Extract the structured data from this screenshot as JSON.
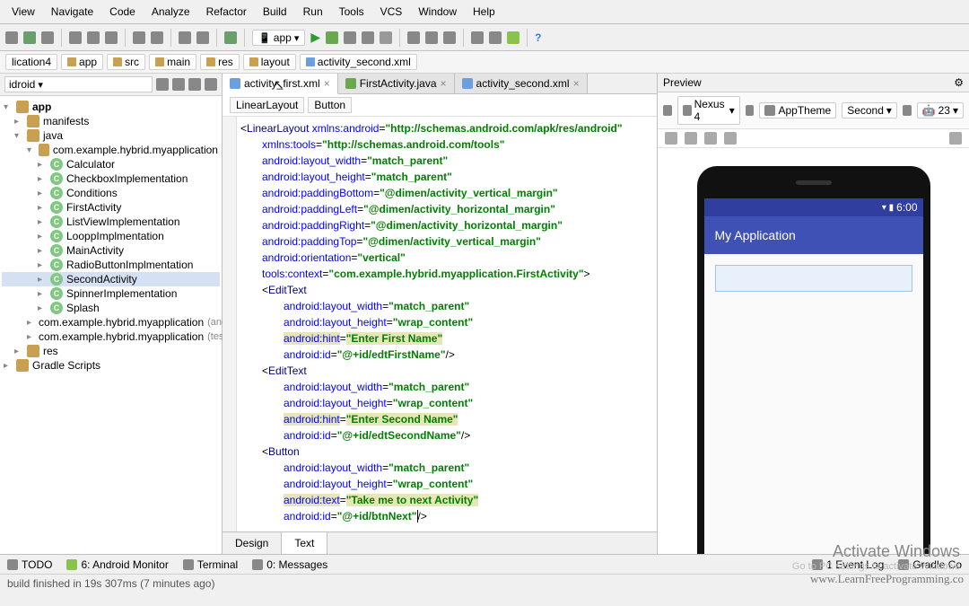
{
  "menu": {
    "items": [
      "View",
      "Navigate",
      "Code",
      "Analyze",
      "Refactor",
      "Build",
      "Run",
      "Tools",
      "VCS",
      "Window",
      "Help"
    ]
  },
  "toolbar": {
    "run_config": "app"
  },
  "breadcrumb": {
    "items": [
      "lication4",
      "app",
      "src",
      "main",
      "res",
      "layout",
      "activity_second.xml"
    ]
  },
  "sidebar": {
    "dropdown": "idroid",
    "root": "app",
    "nodes": [
      {
        "label": "manifests",
        "ico": "folder",
        "indent": 1
      },
      {
        "label": "java",
        "ico": "folder",
        "indent": 1,
        "exp": "▾"
      },
      {
        "label": "com.example.hybrid.myapplication",
        "ico": "folder",
        "indent": 2,
        "exp": "▾"
      },
      {
        "label": "Calculator",
        "ico": "c",
        "indent": 3
      },
      {
        "label": "CheckboxImplementation",
        "ico": "c",
        "indent": 3
      },
      {
        "label": "Conditions",
        "ico": "c",
        "indent": 3
      },
      {
        "label": "FirstActivity",
        "ico": "c",
        "indent": 3
      },
      {
        "label": "ListViewImplementation",
        "ico": "c",
        "indent": 3
      },
      {
        "label": "LooppImplmentation",
        "ico": "c",
        "indent": 3
      },
      {
        "label": "MainActivity",
        "ico": "c",
        "indent": 3
      },
      {
        "label": "RadioButtonImplmentation",
        "ico": "c",
        "indent": 3
      },
      {
        "label": "SecondActivity",
        "ico": "c",
        "indent": 3,
        "sel": true
      },
      {
        "label": "SpinnerImplementation",
        "ico": "c",
        "indent": 3
      },
      {
        "label": "Splash",
        "ico": "c",
        "indent": 3
      },
      {
        "label": "com.example.hybrid.myapplication",
        "ico": "folder",
        "indent": 2,
        "suffix": "(androidTe"
      },
      {
        "label": "com.example.hybrid.myapplication",
        "ico": "folder",
        "indent": 2,
        "suffix": "(test)"
      },
      {
        "label": "res",
        "ico": "folder",
        "indent": 1
      },
      {
        "label": "Gradle Scripts",
        "ico": "folder",
        "indent": 0
      }
    ]
  },
  "editor": {
    "tabs": [
      {
        "label": "activity_first.xml",
        "active": true
      },
      {
        "label": "FirstActivity.java",
        "active": false
      },
      {
        "label": "activity_second.xml",
        "active": false
      }
    ],
    "crumb": [
      "LinearLayout",
      "Button"
    ],
    "bottom_tabs": {
      "design": "Design",
      "text": "Text"
    }
  },
  "code": {
    "root": {
      "tag": "LinearLayout",
      "ns": "xmlns:android",
      "nsv": "http://schemas.android.com/apk/res/android",
      "attrs": [
        {
          "n": "xmlns:tools",
          "v": "http://schemas.android.com/tools"
        },
        {
          "n": "android:layout_width",
          "v": "match_parent"
        },
        {
          "n": "android:layout_height",
          "v": "match_parent"
        },
        {
          "n": "android:paddingBottom",
          "v": "@dimen/activity_vertical_margin"
        },
        {
          "n": "android:paddingLeft",
          "v": "@dimen/activity_horizontal_margin"
        },
        {
          "n": "android:paddingRight",
          "v": "@dimen/activity_horizontal_margin"
        },
        {
          "n": "android:paddingTop",
          "v": "@dimen/activity_vertical_margin"
        },
        {
          "n": "android:orientation",
          "v": "vertical"
        },
        {
          "n": "tools:context",
          "v": "com.example.hybrid.myapplication.FirstActivity"
        }
      ]
    },
    "children": [
      {
        "tag": "EditText",
        "attrs": [
          {
            "n": "android:layout_width",
            "v": "match_parent"
          },
          {
            "n": "android:layout_height",
            "v": "wrap_content"
          },
          {
            "n": "android:hint",
            "v": "Enter First Name",
            "hl": true
          },
          {
            "n": "android:id",
            "v": "@+id/edtFirstName"
          }
        ]
      },
      {
        "tag": "EditText",
        "attrs": [
          {
            "n": "android:layout_width",
            "v": "match_parent"
          },
          {
            "n": "android:layout_height",
            "v": "wrap_content"
          },
          {
            "n": "android:hint",
            "v": "Enter Second Name",
            "hl": true
          },
          {
            "n": "android:id",
            "v": "@+id/edtSecondName"
          }
        ]
      },
      {
        "tag": "Button",
        "attrs": [
          {
            "n": "android:layout_width",
            "v": "match_parent"
          },
          {
            "n": "android:layout_height",
            "v": "wrap_content"
          },
          {
            "n": "android:text",
            "v": "Take me to next Activity",
            "hl": true
          },
          {
            "n": "android:id",
            "v": "@+id/btnNext",
            "caret": true
          }
        ]
      }
    ]
  },
  "preview": {
    "title": "Preview",
    "device": "Nexus 4",
    "theme": "AppTheme",
    "variant": "Second",
    "api": "23",
    "app_title": "My Application",
    "clock": "6:00"
  },
  "bottombar": {
    "items": [
      "TODO",
      "6: Android Monitor",
      "Terminal",
      "0: Messages"
    ],
    "right": [
      "1  Event Log",
      "Gradle Co"
    ]
  },
  "status": {
    "msg": "build finished in 19s 307ms (7 minutes ago)"
  },
  "watermark": {
    "title": "Activate Windows",
    "sub": "Go to PC settings to activate Windows"
  },
  "brand": "www.LearnFreeProgramming.co"
}
